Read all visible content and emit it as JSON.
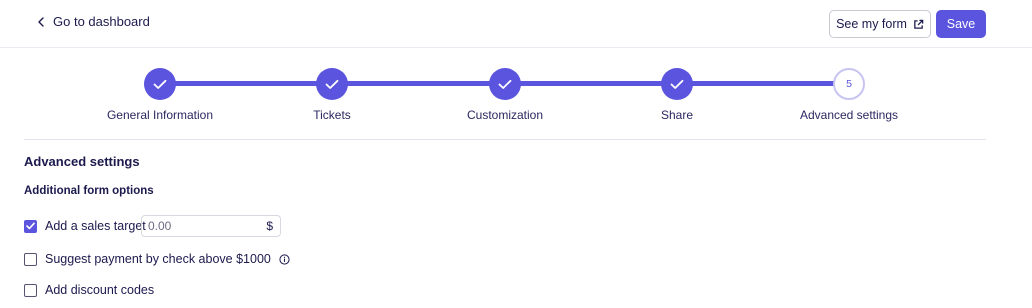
{
  "header": {
    "back_label": "Go to dashboard",
    "see_form_label": "See my form",
    "save_label": "Save"
  },
  "stepper": {
    "steps": [
      {
        "label": "General Information",
        "status": "done"
      },
      {
        "label": "Tickets",
        "status": "done"
      },
      {
        "label": "Customization",
        "status": "done"
      },
      {
        "label": "Share",
        "status": "done"
      },
      {
        "label": "Advanced settings",
        "status": "current",
        "number": "5"
      }
    ]
  },
  "section": {
    "title": "Advanced settings",
    "subtitle": "Additional form options"
  },
  "options": {
    "sales_target": {
      "label": "Add a sales target",
      "checked": true,
      "amount_placeholder": "0.00",
      "currency": "$"
    },
    "check_payment": {
      "label": "Suggest payment by check above $1000",
      "checked": false
    },
    "discount_codes": {
      "label": "Add discount codes",
      "checked": false
    }
  },
  "colors": {
    "accent": "#5b54de",
    "text": "#1c1a4d"
  }
}
